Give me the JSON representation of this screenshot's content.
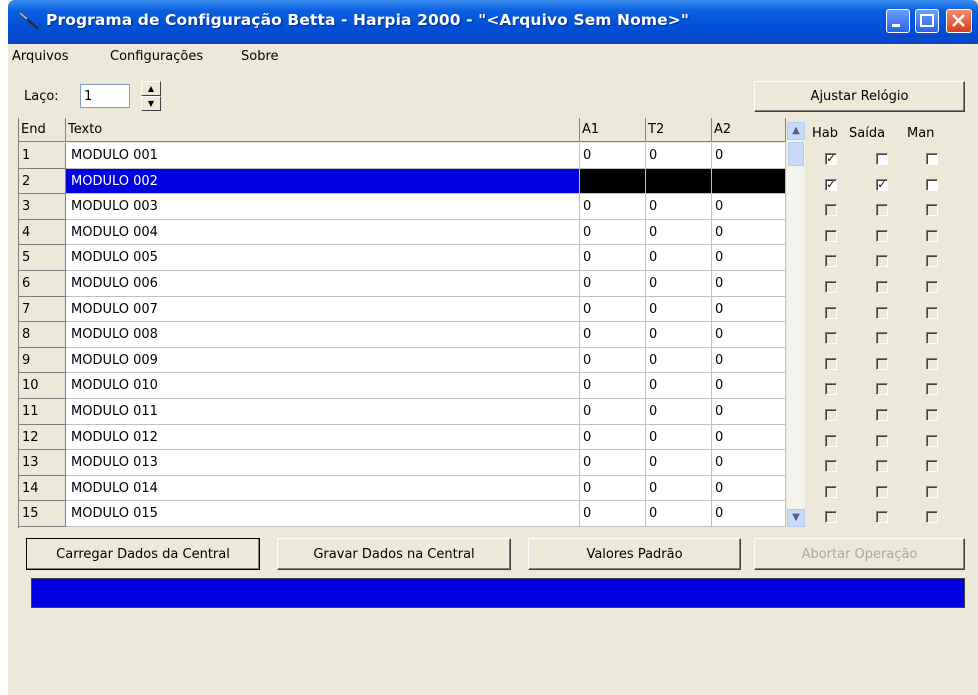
{
  "window": {
    "title": "Programa de Configuração Betta - Harpia 2000 - \"<Arquivo Sem Nome>\""
  },
  "menu": [
    "Arquivos",
    "Configurações",
    "Sobre"
  ],
  "laco": {
    "label": "Laço:",
    "value": "1"
  },
  "buttons": {
    "ajustar_relogio": "Ajustar Relógio",
    "carregar": "Carregar Dados da Central",
    "gravar": "Gravar Dados na Central",
    "valores_padrao": "Valores Padrão",
    "abortar": "Abortar Operação"
  },
  "grid": {
    "headers": {
      "end": "End",
      "texto": "Texto",
      "a1": "A1",
      "t2": "T2",
      "a2": "A2"
    },
    "rows": [
      {
        "end": "1",
        "texto": "MODULO 001",
        "a1": "0",
        "t2": "0",
        "a2": "0"
      },
      {
        "end": "2",
        "texto": "MODULO 002",
        "a1": "",
        "t2": "",
        "a2": ""
      },
      {
        "end": "3",
        "texto": "MODULO 003",
        "a1": "0",
        "t2": "0",
        "a2": "0"
      },
      {
        "end": "4",
        "texto": "MODULO 004",
        "a1": "0",
        "t2": "0",
        "a2": "0"
      },
      {
        "end": "5",
        "texto": "MODULO 005",
        "a1": "0",
        "t2": "0",
        "a2": "0"
      },
      {
        "end": "6",
        "texto": "MODULO 006",
        "a1": "0",
        "t2": "0",
        "a2": "0"
      },
      {
        "end": "7",
        "texto": "MODULO 007",
        "a1": "0",
        "t2": "0",
        "a2": "0"
      },
      {
        "end": "8",
        "texto": "MODULO 008",
        "a1": "0",
        "t2": "0",
        "a2": "0"
      },
      {
        "end": "9",
        "texto": "MODULO 009",
        "a1": "0",
        "t2": "0",
        "a2": "0"
      },
      {
        "end": "10",
        "texto": "MODULO 010",
        "a1": "0",
        "t2": "0",
        "a2": "0"
      },
      {
        "end": "11",
        "texto": "MODULO 011",
        "a1": "0",
        "t2": "0",
        "a2": "0"
      },
      {
        "end": "12",
        "texto": "MODULO 012",
        "a1": "0",
        "t2": "0",
        "a2": "0"
      },
      {
        "end": "13",
        "texto": "MODULO 013",
        "a1": "0",
        "t2": "0",
        "a2": "0"
      },
      {
        "end": "14",
        "texto": "MODULO 014",
        "a1": "0",
        "t2": "0",
        "a2": "0"
      },
      {
        "end": "15",
        "texto": "MODULO 015",
        "a1": "0",
        "t2": "0",
        "a2": "0"
      }
    ]
  },
  "checks": {
    "headers": {
      "hab": "Hab",
      "saida": "Saída",
      "man": "Man"
    },
    "rows": [
      {
        "hab": true,
        "saida": false,
        "man": false
      },
      {
        "hab": true,
        "saida": true,
        "man": false
      },
      {
        "hab": false,
        "saida": false,
        "man": false
      },
      {
        "hab": false,
        "saida": false,
        "man": false
      },
      {
        "hab": false,
        "saida": false,
        "man": false
      },
      {
        "hab": false,
        "saida": false,
        "man": false
      },
      {
        "hab": false,
        "saida": false,
        "man": false
      },
      {
        "hab": false,
        "saida": false,
        "man": false
      },
      {
        "hab": false,
        "saida": false,
        "man": false
      },
      {
        "hab": false,
        "saida": false,
        "man": false
      },
      {
        "hab": false,
        "saida": false,
        "man": false
      },
      {
        "hab": false,
        "saida": false,
        "man": false
      },
      {
        "hab": false,
        "saida": false,
        "man": false
      },
      {
        "hab": false,
        "saida": false,
        "man": false
      },
      {
        "hab": false,
        "saida": false,
        "man": false
      }
    ]
  },
  "colors": {
    "selection": "#0000e0",
    "progress": "#0000e0"
  }
}
